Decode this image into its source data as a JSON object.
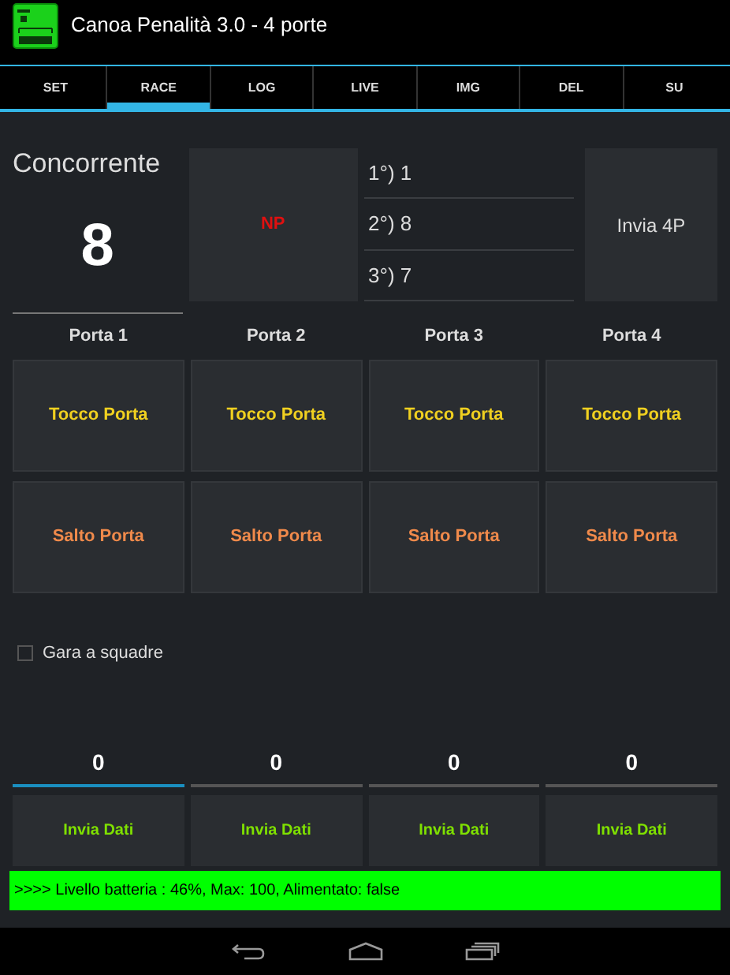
{
  "window": {
    "title": "Canoa Penalità 3.0 - 4 porte"
  },
  "tabs": [
    {
      "label": "SET",
      "selected": false
    },
    {
      "label": "RACE",
      "selected": true
    },
    {
      "label": "LOG",
      "selected": false
    },
    {
      "label": "LIVE",
      "selected": false
    },
    {
      "label": "IMG",
      "selected": false
    },
    {
      "label": "DEL",
      "selected": false
    },
    {
      "label": "SU",
      "selected": false
    }
  ],
  "competitor": {
    "label": "Concorrente",
    "value": "8"
  },
  "np_button": "NP",
  "ranking": [
    "1°) 1",
    "2°) 8",
    "3°) 7"
  ],
  "send_4p_button": "Invia 4P",
  "gates": [
    {
      "label": "Porta 1",
      "touch": "Tocco Porta",
      "jump": "Salto Porta",
      "value": "0",
      "focused": true,
      "send": "Invia Dati"
    },
    {
      "label": "Porta 2",
      "touch": "Tocco Porta",
      "jump": "Salto Porta",
      "value": "0",
      "focused": false,
      "send": "Invia Dati"
    },
    {
      "label": "Porta 3",
      "touch": "Tocco Porta",
      "jump": "Salto Porta",
      "value": "0",
      "focused": false,
      "send": "Invia Dati"
    },
    {
      "label": "Porta 4",
      "touch": "Tocco Porta",
      "jump": "Salto Porta",
      "value": "0",
      "focused": false,
      "send": "Invia Dati"
    }
  ],
  "team_race": {
    "label": "Gara a squadre",
    "checked": false
  },
  "status_bar": ">>>> Livello batteria : 46%, Max: 100, Alimentato: false"
}
